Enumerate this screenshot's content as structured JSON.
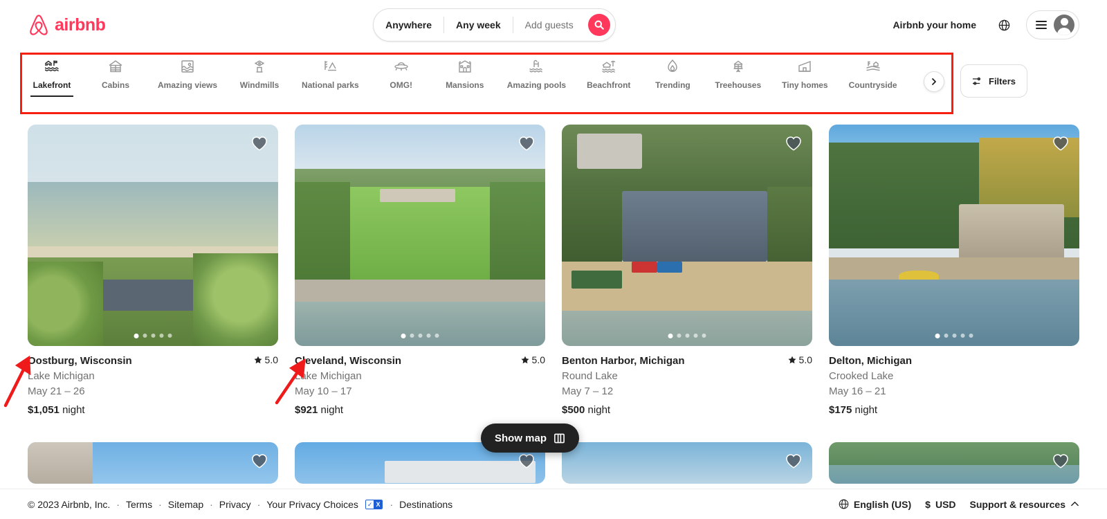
{
  "header": {
    "brand": "airbnb",
    "logo_color": "#FF385C",
    "search": {
      "where": "Anywhere",
      "when": "Any week",
      "guests_placeholder": "Add guests",
      "search_icon": "search-icon"
    },
    "host_link": "Airbnb your home",
    "globe_icon": "globe-icon",
    "menu_icon": "hamburger-icon",
    "avatar_icon": "user-avatar-icon"
  },
  "categories": {
    "items": [
      {
        "label": "Lakefront",
        "icon": "lakefront-icon",
        "active": true
      },
      {
        "label": "Cabins",
        "icon": "cabin-icon",
        "active": false
      },
      {
        "label": "Amazing views",
        "icon": "amazing-views-icon",
        "active": false
      },
      {
        "label": "Windmills",
        "icon": "windmill-icon",
        "active": false
      },
      {
        "label": "National parks",
        "icon": "national-parks-icon",
        "active": false
      },
      {
        "label": "OMG!",
        "icon": "omg-ufo-icon",
        "active": false
      },
      {
        "label": "Mansions",
        "icon": "mansion-icon",
        "active": false
      },
      {
        "label": "Amazing pools",
        "icon": "amazing-pools-icon",
        "active": false
      },
      {
        "label": "Beachfront",
        "icon": "beachfront-icon",
        "active": false
      },
      {
        "label": "Trending",
        "icon": "flame-icon",
        "active": false
      },
      {
        "label": "Treehouses",
        "icon": "treehouse-icon",
        "active": false
      },
      {
        "label": "Tiny homes",
        "icon": "tiny-home-icon",
        "active": false
      },
      {
        "label": "Countryside",
        "icon": "countryside-icon",
        "active": false
      }
    ],
    "next_label": "chevron-right-icon",
    "filters_label": "Filters",
    "filters_icon": "filters-sliders-icon",
    "highlight_color": "#f61f0f"
  },
  "listings": [
    {
      "title": "Oostburg, Wisconsin",
      "rating": "5.0",
      "subtitle": "Lake Michigan",
      "dates": "May 21 – 26",
      "price": "$1,051",
      "price_unit": "night",
      "photo_count": 5,
      "photo_index": 1,
      "saved": false
    },
    {
      "title": "Cleveland, Wisconsin",
      "rating": "5.0",
      "subtitle": "Lake Michigan",
      "dates": "May 10 – 17",
      "price": "$921",
      "price_unit": "night",
      "photo_count": 5,
      "photo_index": 1,
      "saved": false
    },
    {
      "title": "Benton Harbor, Michigan",
      "rating": "5.0",
      "subtitle": "Round Lake",
      "dates": "May 7 – 12",
      "price": "$500",
      "price_unit": "night",
      "photo_count": 5,
      "photo_index": 1,
      "saved": false
    },
    {
      "title": "Delton, Michigan",
      "rating": "",
      "subtitle": "Crooked Lake",
      "dates": "May 16 – 21",
      "price": "$175",
      "price_unit": "night",
      "photo_count": 5,
      "photo_index": 1,
      "saved": false
    }
  ],
  "map_button": {
    "label": "Show map",
    "icon": "map-icon"
  },
  "footer": {
    "copyright": "© 2023 Airbnb, Inc.",
    "links": [
      "Terms",
      "Sitemap",
      "Privacy",
      "Your Privacy Choices",
      "Destinations"
    ],
    "privacy_badge": {
      "left": "✓",
      "right": "X"
    },
    "language": "English (US)",
    "language_icon": "globe-icon",
    "currency_symbol": "$",
    "currency": "USD",
    "support": "Support & resources",
    "support_icon": "chevron-up-icon"
  },
  "annotations": {
    "box_color": "#f61f0f",
    "arrow_color": "#ef1a1a",
    "arrow_count": 2
  }
}
